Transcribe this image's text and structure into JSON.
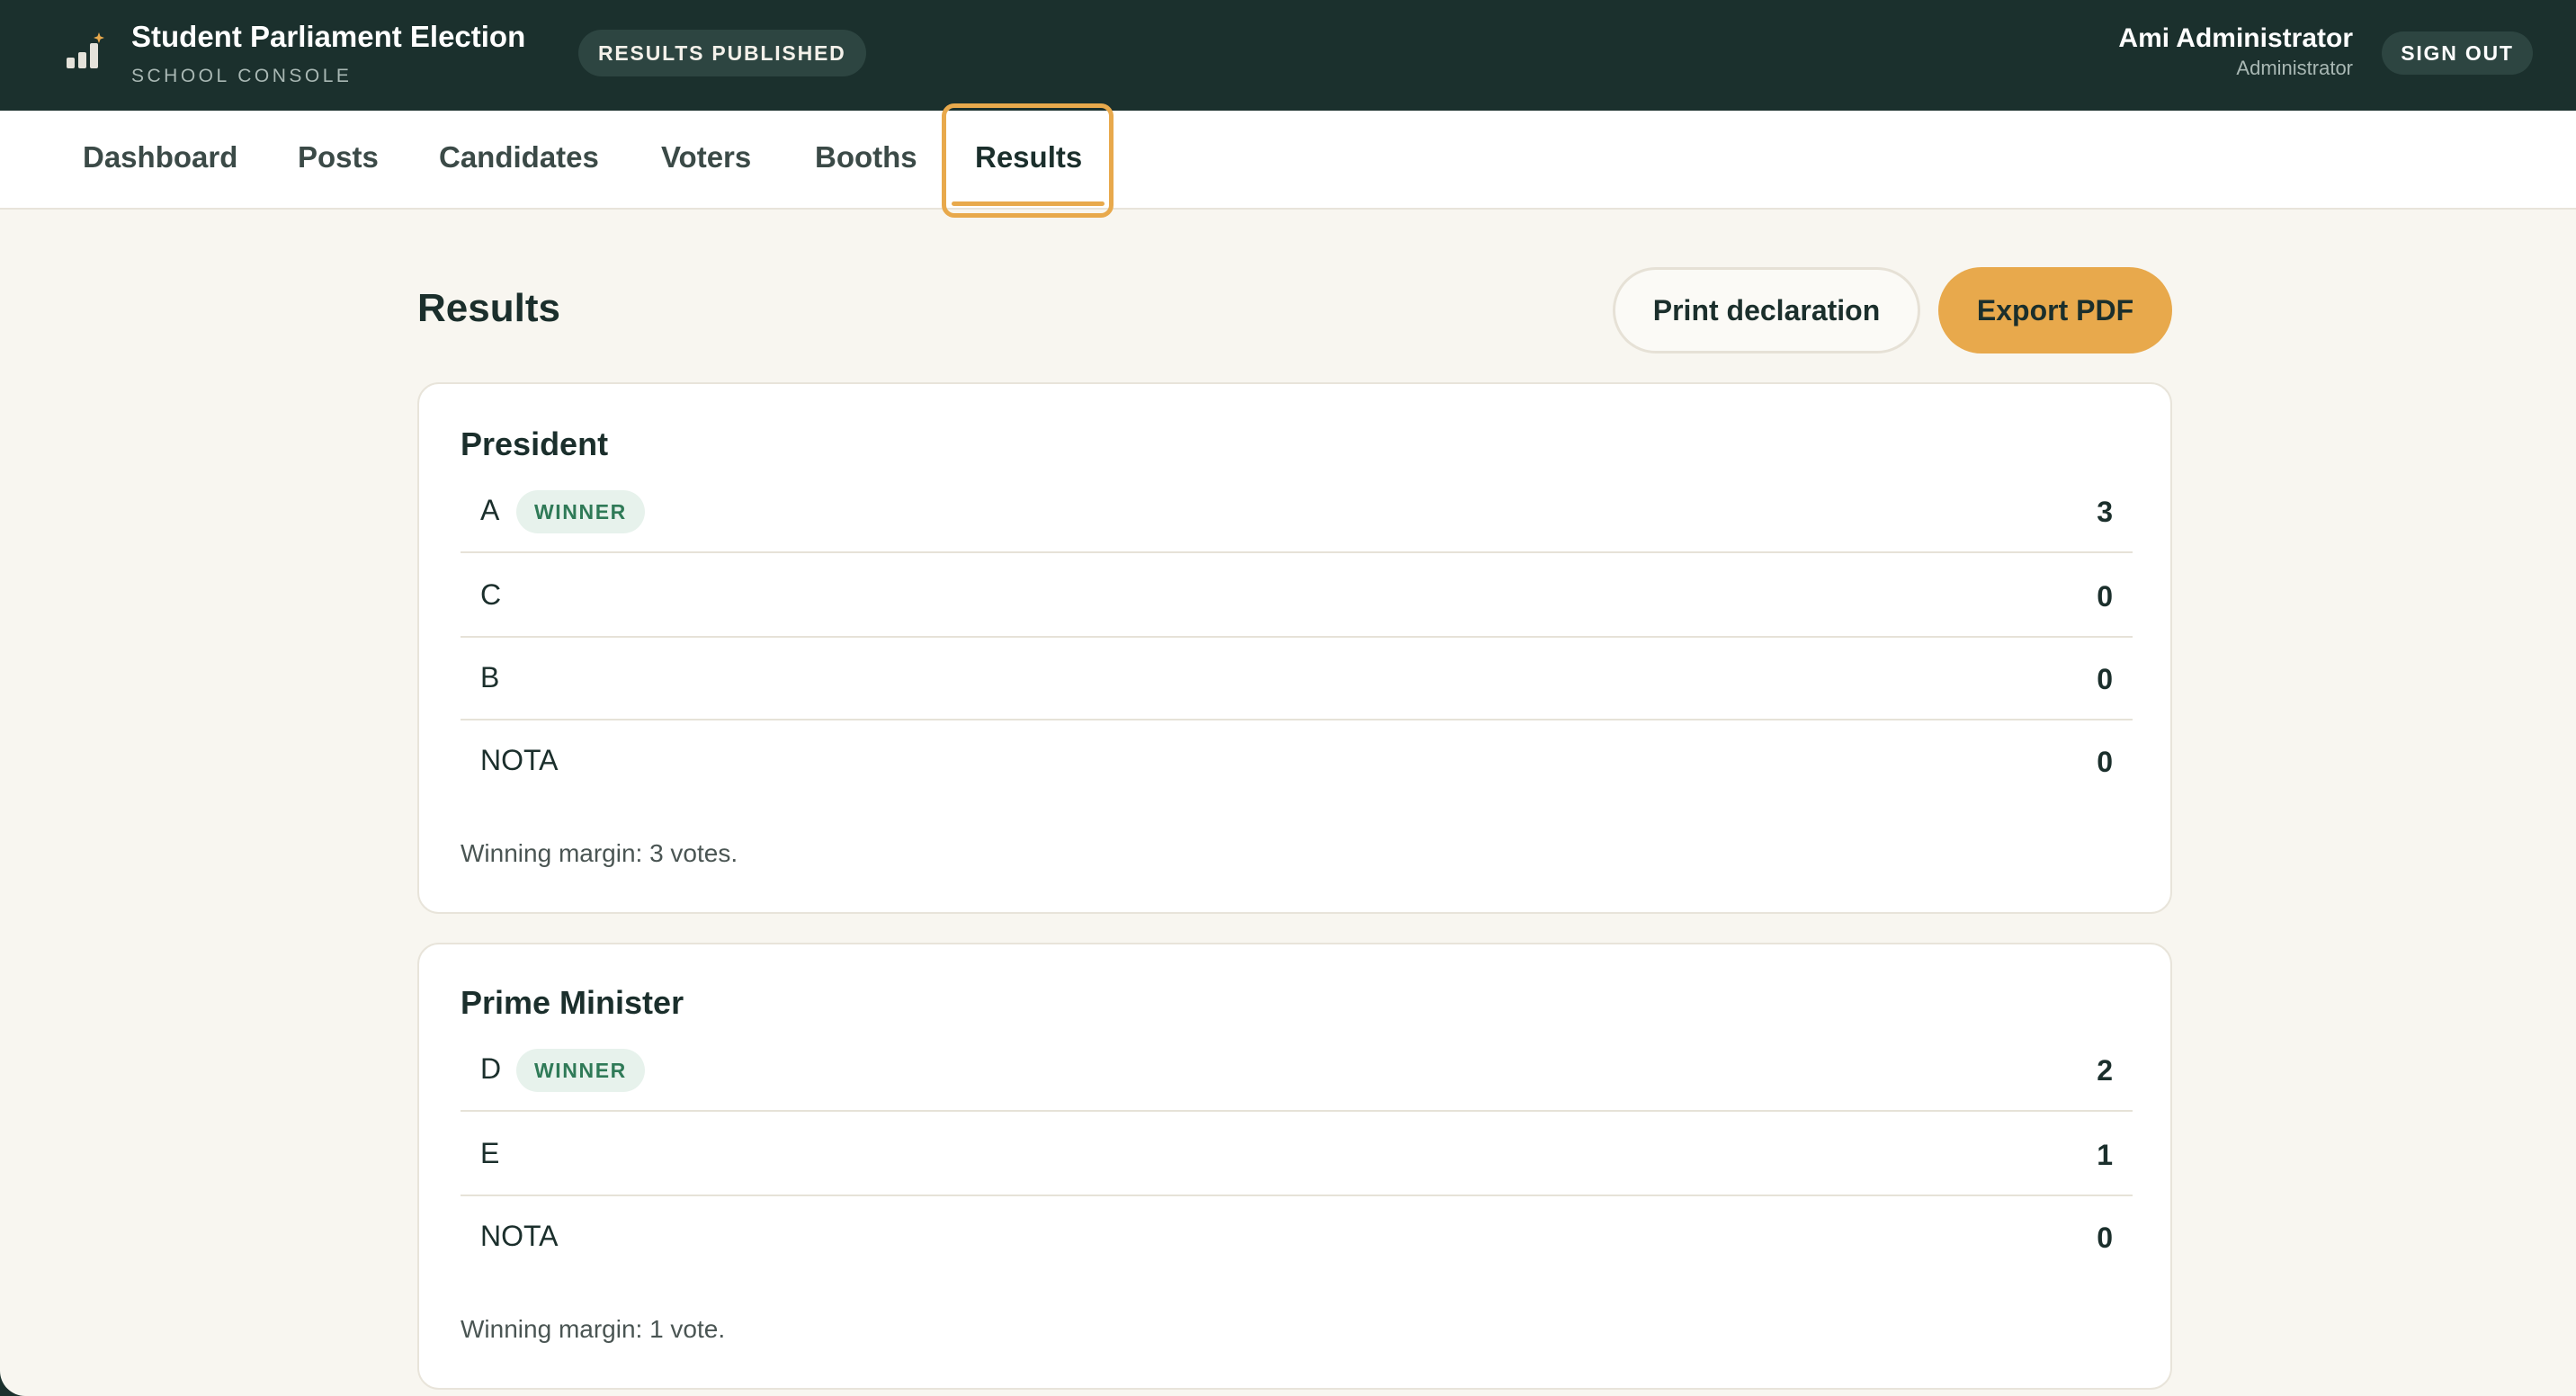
{
  "header": {
    "app_title": "Student Parliament Election",
    "app_subtitle": "SCHOOL CONSOLE",
    "status_badge": "RESULTS PUBLISHED",
    "user_name": "Ami Administrator",
    "user_role": "Administrator",
    "signout_label": "SIGN OUT",
    "logo_icon": "bar-chart-sparkle-icon"
  },
  "nav": {
    "items": [
      "Dashboard",
      "Posts",
      "Candidates",
      "Voters",
      "Booths",
      "Results"
    ],
    "active": "Results"
  },
  "page": {
    "title": "Results",
    "print_label": "Print declaration",
    "export_label": "Export PDF"
  },
  "posts": [
    {
      "title": "President",
      "candidates": [
        {
          "name": "A",
          "votes": "3",
          "winner": true
        },
        {
          "name": "C",
          "votes": "0",
          "winner": false
        },
        {
          "name": "B",
          "votes": "0",
          "winner": false
        },
        {
          "name": "NOTA",
          "votes": "0",
          "winner": false
        }
      ],
      "winner_label": "WINNER",
      "margin": "Winning margin: 3 votes."
    },
    {
      "title": "Prime Minister",
      "candidates": [
        {
          "name": "D",
          "votes": "2",
          "winner": true
        },
        {
          "name": "E",
          "votes": "1",
          "winner": false
        },
        {
          "name": "NOTA",
          "votes": "0",
          "winner": false
        }
      ],
      "winner_label": "WINNER",
      "margin": "Winning margin: 1 vote."
    }
  ],
  "colors": {
    "topbar": "#1b302d",
    "accent": "#e8a94c",
    "page_bg": "#f8f6f0",
    "winner_bg": "#e7f2ec",
    "winner_text": "#2f7a57"
  }
}
